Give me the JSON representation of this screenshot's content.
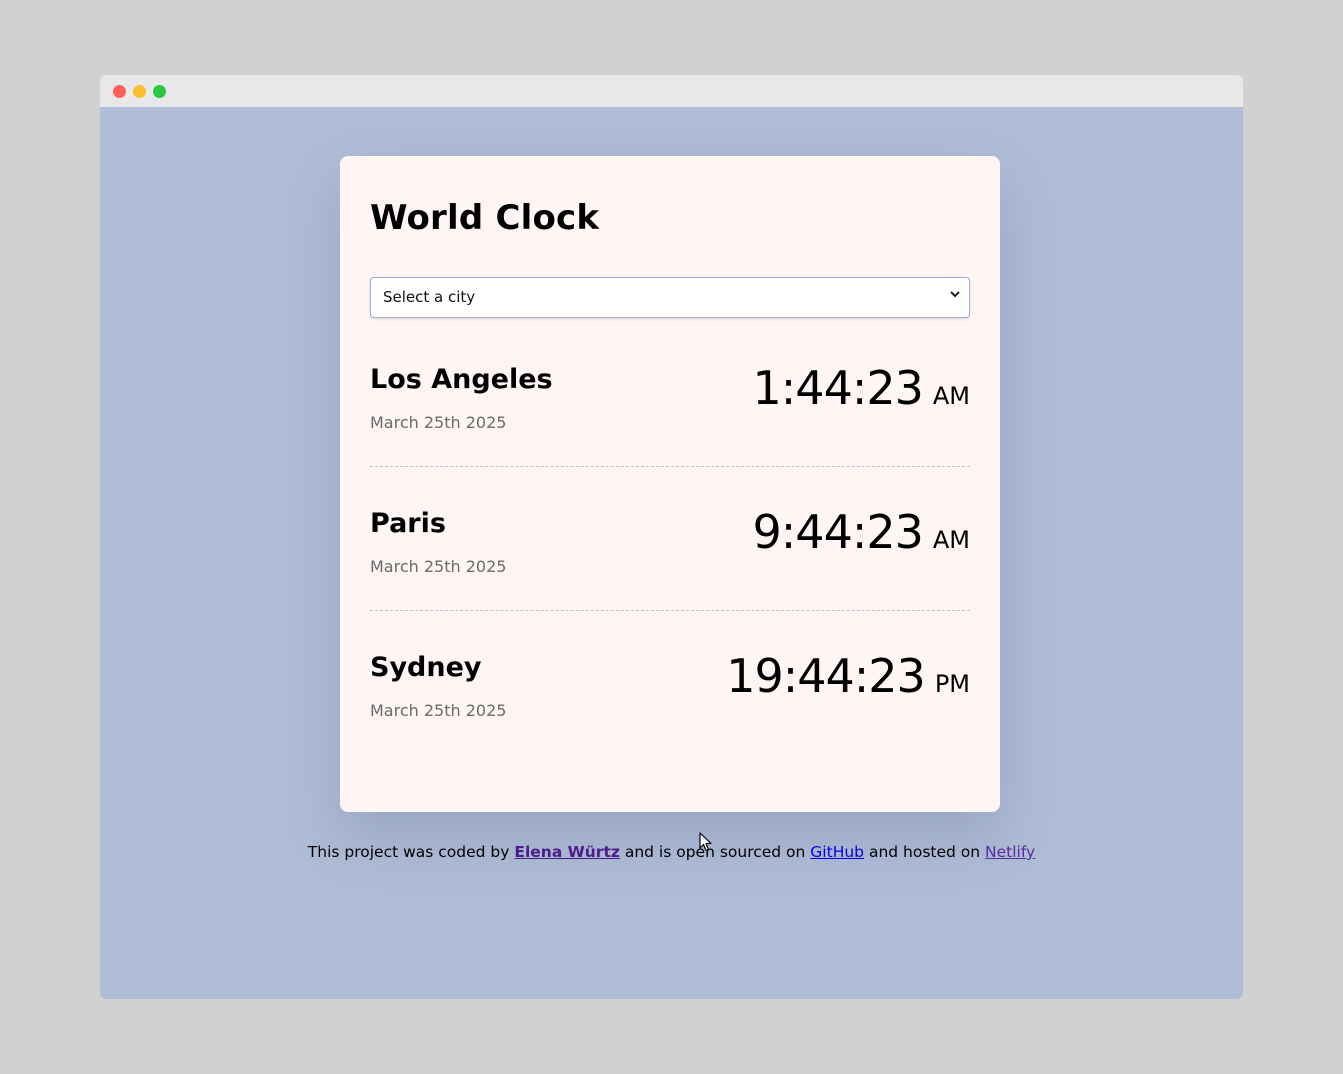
{
  "app": {
    "title": "World Clock"
  },
  "city_select": {
    "selected_label": "Select a city",
    "chevron_icon": "chevron-down-icon"
  },
  "cities": [
    {
      "name": "Los Angeles",
      "date": "March 25th 2025",
      "time": "1:44:23",
      "period": "AM"
    },
    {
      "name": "Paris",
      "date": "March 25th 2025",
      "time": "9:44:23",
      "period": "AM"
    },
    {
      "name": "Sydney",
      "date": "March 25th 2025",
      "time": "19:44:23",
      "period": "PM"
    }
  ],
  "footer": {
    "text_1": "This project was coded by ",
    "author_link": "Elena Würtz",
    "text_2": " and is open sourced on ",
    "github_link": "GitHub",
    "text_3": " and hosted on ",
    "netlify_link": "Netlify"
  },
  "colors": {
    "page_background": "#b0bdd6",
    "card_background": "#fef5f4",
    "date_text": "#6b6b6b",
    "author_link": "#4b1c8a",
    "github_link": "#0b00e0",
    "netlify_link": "#5a2aa0"
  }
}
